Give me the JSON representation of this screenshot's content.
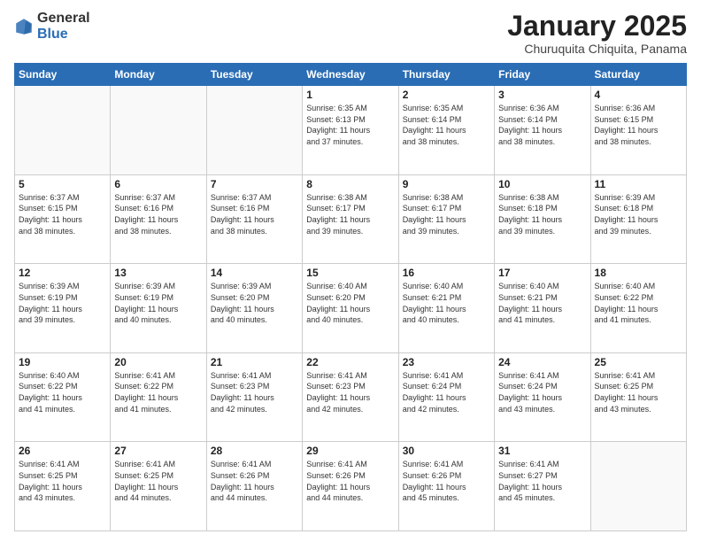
{
  "header": {
    "logo_general": "General",
    "logo_blue": "Blue",
    "month": "January 2025",
    "location": "Churuquita Chiquita, Panama"
  },
  "weekdays": [
    "Sunday",
    "Monday",
    "Tuesday",
    "Wednesday",
    "Thursday",
    "Friday",
    "Saturday"
  ],
  "weeks": [
    [
      {
        "day": "",
        "info": ""
      },
      {
        "day": "",
        "info": ""
      },
      {
        "day": "",
        "info": ""
      },
      {
        "day": "1",
        "info": "Sunrise: 6:35 AM\nSunset: 6:13 PM\nDaylight: 11 hours\nand 37 minutes."
      },
      {
        "day": "2",
        "info": "Sunrise: 6:35 AM\nSunset: 6:14 PM\nDaylight: 11 hours\nand 38 minutes."
      },
      {
        "day": "3",
        "info": "Sunrise: 6:36 AM\nSunset: 6:14 PM\nDaylight: 11 hours\nand 38 minutes."
      },
      {
        "day": "4",
        "info": "Sunrise: 6:36 AM\nSunset: 6:15 PM\nDaylight: 11 hours\nand 38 minutes."
      }
    ],
    [
      {
        "day": "5",
        "info": "Sunrise: 6:37 AM\nSunset: 6:15 PM\nDaylight: 11 hours\nand 38 minutes."
      },
      {
        "day": "6",
        "info": "Sunrise: 6:37 AM\nSunset: 6:16 PM\nDaylight: 11 hours\nand 38 minutes."
      },
      {
        "day": "7",
        "info": "Sunrise: 6:37 AM\nSunset: 6:16 PM\nDaylight: 11 hours\nand 38 minutes."
      },
      {
        "day": "8",
        "info": "Sunrise: 6:38 AM\nSunset: 6:17 PM\nDaylight: 11 hours\nand 39 minutes."
      },
      {
        "day": "9",
        "info": "Sunrise: 6:38 AM\nSunset: 6:17 PM\nDaylight: 11 hours\nand 39 minutes."
      },
      {
        "day": "10",
        "info": "Sunrise: 6:38 AM\nSunset: 6:18 PM\nDaylight: 11 hours\nand 39 minutes."
      },
      {
        "day": "11",
        "info": "Sunrise: 6:39 AM\nSunset: 6:18 PM\nDaylight: 11 hours\nand 39 minutes."
      }
    ],
    [
      {
        "day": "12",
        "info": "Sunrise: 6:39 AM\nSunset: 6:19 PM\nDaylight: 11 hours\nand 39 minutes."
      },
      {
        "day": "13",
        "info": "Sunrise: 6:39 AM\nSunset: 6:19 PM\nDaylight: 11 hours\nand 40 minutes."
      },
      {
        "day": "14",
        "info": "Sunrise: 6:39 AM\nSunset: 6:20 PM\nDaylight: 11 hours\nand 40 minutes."
      },
      {
        "day": "15",
        "info": "Sunrise: 6:40 AM\nSunset: 6:20 PM\nDaylight: 11 hours\nand 40 minutes."
      },
      {
        "day": "16",
        "info": "Sunrise: 6:40 AM\nSunset: 6:21 PM\nDaylight: 11 hours\nand 40 minutes."
      },
      {
        "day": "17",
        "info": "Sunrise: 6:40 AM\nSunset: 6:21 PM\nDaylight: 11 hours\nand 41 minutes."
      },
      {
        "day": "18",
        "info": "Sunrise: 6:40 AM\nSunset: 6:22 PM\nDaylight: 11 hours\nand 41 minutes."
      }
    ],
    [
      {
        "day": "19",
        "info": "Sunrise: 6:40 AM\nSunset: 6:22 PM\nDaylight: 11 hours\nand 41 minutes."
      },
      {
        "day": "20",
        "info": "Sunrise: 6:41 AM\nSunset: 6:22 PM\nDaylight: 11 hours\nand 41 minutes."
      },
      {
        "day": "21",
        "info": "Sunrise: 6:41 AM\nSunset: 6:23 PM\nDaylight: 11 hours\nand 42 minutes."
      },
      {
        "day": "22",
        "info": "Sunrise: 6:41 AM\nSunset: 6:23 PM\nDaylight: 11 hours\nand 42 minutes."
      },
      {
        "day": "23",
        "info": "Sunrise: 6:41 AM\nSunset: 6:24 PM\nDaylight: 11 hours\nand 42 minutes."
      },
      {
        "day": "24",
        "info": "Sunrise: 6:41 AM\nSunset: 6:24 PM\nDaylight: 11 hours\nand 43 minutes."
      },
      {
        "day": "25",
        "info": "Sunrise: 6:41 AM\nSunset: 6:25 PM\nDaylight: 11 hours\nand 43 minutes."
      }
    ],
    [
      {
        "day": "26",
        "info": "Sunrise: 6:41 AM\nSunset: 6:25 PM\nDaylight: 11 hours\nand 43 minutes."
      },
      {
        "day": "27",
        "info": "Sunrise: 6:41 AM\nSunset: 6:25 PM\nDaylight: 11 hours\nand 44 minutes."
      },
      {
        "day": "28",
        "info": "Sunrise: 6:41 AM\nSunset: 6:26 PM\nDaylight: 11 hours\nand 44 minutes."
      },
      {
        "day": "29",
        "info": "Sunrise: 6:41 AM\nSunset: 6:26 PM\nDaylight: 11 hours\nand 44 minutes."
      },
      {
        "day": "30",
        "info": "Sunrise: 6:41 AM\nSunset: 6:26 PM\nDaylight: 11 hours\nand 45 minutes."
      },
      {
        "day": "31",
        "info": "Sunrise: 6:41 AM\nSunset: 6:27 PM\nDaylight: 11 hours\nand 45 minutes."
      },
      {
        "day": "",
        "info": ""
      }
    ]
  ]
}
